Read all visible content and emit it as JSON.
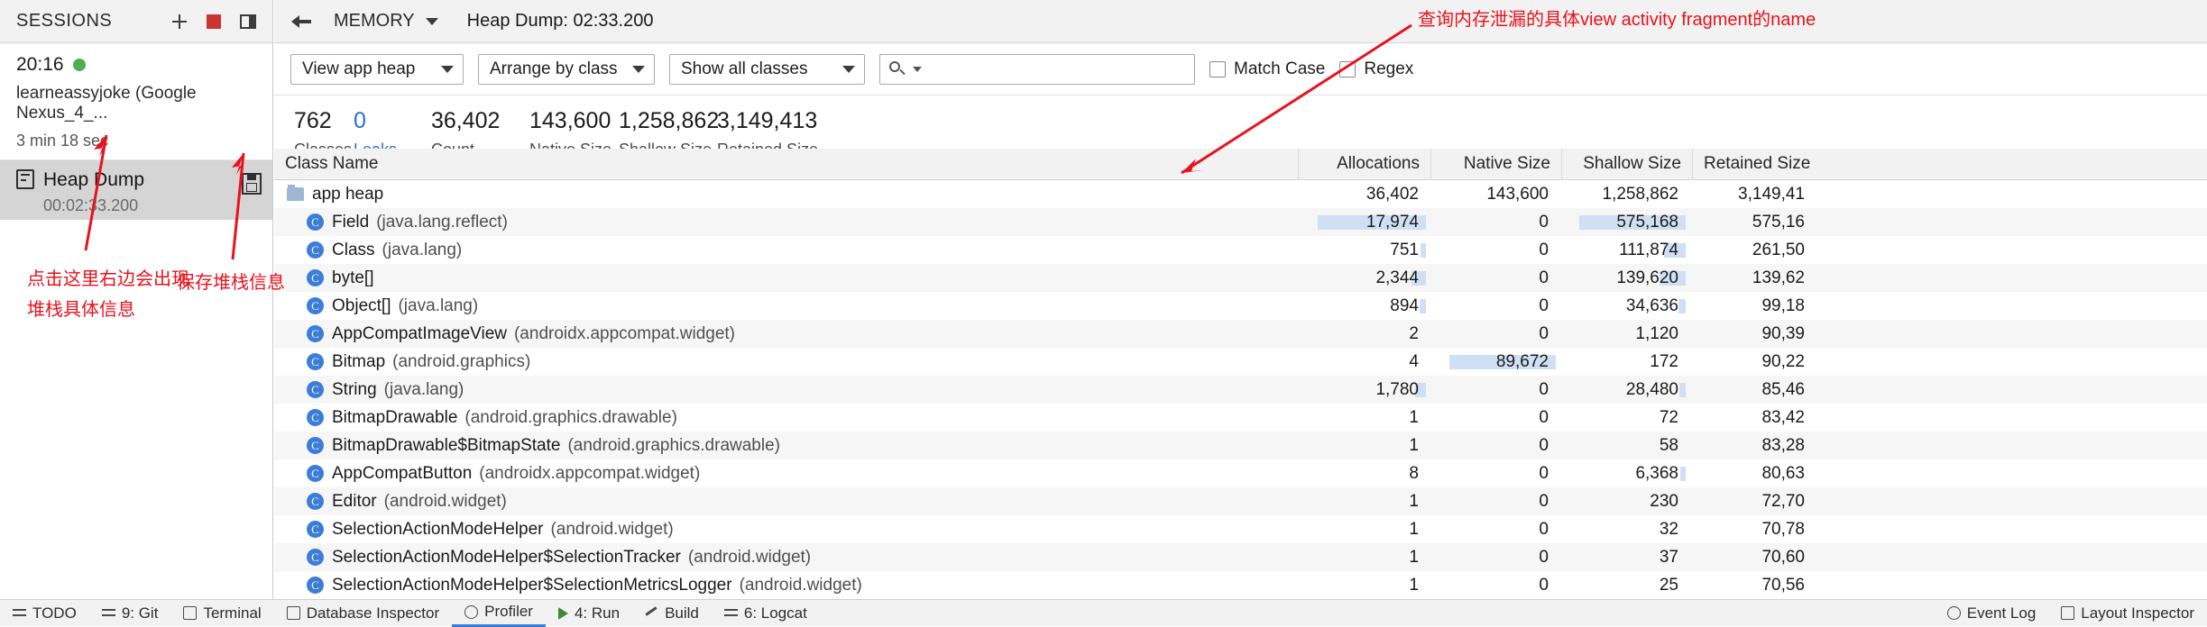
{
  "sidebar": {
    "title": "SESSIONS",
    "actions": [
      {
        "name": "add-session-button",
        "icon": "plus-icon"
      },
      {
        "name": "stop-session-button",
        "icon": "stop-icon"
      },
      {
        "name": "toggle-panel-button",
        "icon": "panel-icon"
      }
    ],
    "session": {
      "time": "20:16",
      "device": "learneassyjoke (Google Nexus_4_...",
      "duration": "3 min 18 sec"
    },
    "heap_dump": {
      "label": "Heap Dump",
      "timestamp": "00:02:33.200",
      "save_icon": "save-icon"
    }
  },
  "toolbar": {
    "back_icon": "back-arrow-icon",
    "stage_label": "MEMORY",
    "dump_label": "Heap Dump: 02:33.200"
  },
  "filters": {
    "heap_select": "View app heap",
    "arrange_select": "Arrange by class",
    "classes_select": "Show all classes",
    "search_placeholder": "",
    "search_value": "",
    "match_case_label": "Match Case",
    "regex_label": "Regex"
  },
  "stats": [
    {
      "value": "762",
      "key": "Classes",
      "link": false
    },
    {
      "value": "0",
      "key": "Leaks",
      "link": true
    },
    {
      "value": "36,402",
      "key": "Count",
      "link": false
    },
    {
      "value": "143,600",
      "key": "Native Size",
      "link": false
    },
    {
      "value": "1,258,862",
      "key": "Shallow Size",
      "link": false
    },
    {
      "value": "3,149,413",
      "key": "Retained Size",
      "link": false
    }
  ],
  "table": {
    "headers": [
      "Class Name",
      "Allocations",
      "Native Size",
      "Shallow Size",
      "Retained Size"
    ],
    "rows": [
      {
        "indent": 0,
        "icon": "folder-icon",
        "name": "app heap",
        "pkg": "",
        "alloc": "36,402",
        "native": "143,600",
        "shallow": "1,258,862",
        "retained": "3,149,41",
        "alloc_bar": 0,
        "native_bar": 0,
        "shallow_bar": 0
      },
      {
        "indent": 1,
        "icon": "class-icon",
        "name": "Field",
        "pkg": "(java.lang.reflect)",
        "alloc": "17,974",
        "native": "0",
        "shallow": "575,168",
        "retained": "575,16",
        "alloc_bar": 100,
        "native_bar": 0,
        "shallow_bar": 100
      },
      {
        "indent": 1,
        "icon": "class-icon",
        "name": "Class",
        "pkg": "(java.lang)",
        "alloc": "751",
        "native": "0",
        "shallow": "111,874",
        "retained": "261,50",
        "alloc_bar": 5,
        "native_bar": 0,
        "shallow_bar": 20
      },
      {
        "indent": 1,
        "icon": "class-icon",
        "name": "byte[]",
        "pkg": "",
        "alloc": "2,344",
        "native": "0",
        "shallow": "139,620",
        "retained": "139,62",
        "alloc_bar": 13,
        "native_bar": 0,
        "shallow_bar": 25
      },
      {
        "indent": 1,
        "icon": "class-icon",
        "name": "Object[]",
        "pkg": "(java.lang)",
        "alloc": "894",
        "native": "0",
        "shallow": "34,636",
        "retained": "99,18",
        "alloc_bar": 6,
        "native_bar": 0,
        "shallow_bar": 7
      },
      {
        "indent": 1,
        "icon": "class-icon",
        "name": "AppCompatImageView",
        "pkg": "(androidx.appcompat.widget)",
        "alloc": "2",
        "native": "0",
        "shallow": "1,120",
        "retained": "90,39",
        "alloc_bar": 0,
        "native_bar": 0,
        "shallow_bar": 0
      },
      {
        "indent": 1,
        "icon": "class-icon",
        "name": "Bitmap",
        "pkg": "(android.graphics)",
        "alloc": "4",
        "native": "89,672",
        "shallow": "172",
        "retained": "90,22",
        "alloc_bar": 0,
        "native_bar": 100,
        "shallow_bar": 0
      },
      {
        "indent": 1,
        "icon": "class-icon",
        "name": "String",
        "pkg": "(java.lang)",
        "alloc": "1,780",
        "native": "0",
        "shallow": "28,480",
        "retained": "85,46",
        "alloc_bar": 10,
        "native_bar": 0,
        "shallow_bar": 6
      },
      {
        "indent": 1,
        "icon": "class-icon",
        "name": "BitmapDrawable",
        "pkg": "(android.graphics.drawable)",
        "alloc": "1",
        "native": "0",
        "shallow": "72",
        "retained": "83,42",
        "alloc_bar": 0,
        "native_bar": 0,
        "shallow_bar": 0
      },
      {
        "indent": 1,
        "icon": "class-icon",
        "name": "BitmapDrawable$BitmapState",
        "pkg": "(android.graphics.drawable)",
        "alloc": "1",
        "native": "0",
        "shallow": "58",
        "retained": "83,28",
        "alloc_bar": 0,
        "native_bar": 0,
        "shallow_bar": 0
      },
      {
        "indent": 1,
        "icon": "class-icon",
        "name": "AppCompatButton",
        "pkg": "(androidx.appcompat.widget)",
        "alloc": "8",
        "native": "0",
        "shallow": "6,368",
        "retained": "80,63",
        "alloc_bar": 0,
        "native_bar": 0,
        "shallow_bar": 1
      },
      {
        "indent": 1,
        "icon": "class-icon",
        "name": "Editor",
        "pkg": "(android.widget)",
        "alloc": "1",
        "native": "0",
        "shallow": "230",
        "retained": "72,70",
        "alloc_bar": 0,
        "native_bar": 0,
        "shallow_bar": 0
      },
      {
        "indent": 1,
        "icon": "class-icon",
        "name": "SelectionActionModeHelper",
        "pkg": "(android.widget)",
        "alloc": "1",
        "native": "0",
        "shallow": "32",
        "retained": "70,78",
        "alloc_bar": 0,
        "native_bar": 0,
        "shallow_bar": 0
      },
      {
        "indent": 1,
        "icon": "class-icon",
        "name": "SelectionActionModeHelper$SelectionTracker",
        "pkg": "(android.widget)",
        "alloc": "1",
        "native": "0",
        "shallow": "37",
        "retained": "70,60",
        "alloc_bar": 0,
        "native_bar": 0,
        "shallow_bar": 0
      },
      {
        "indent": 1,
        "icon": "class-icon",
        "name": "SelectionActionModeHelper$SelectionMetricsLogger",
        "pkg": "(android.widget)",
        "alloc": "1",
        "native": "0",
        "shallow": "25",
        "retained": "70,56",
        "alloc_bar": 0,
        "native_bar": 0,
        "shallow_bar": 0
      }
    ]
  },
  "bottom_bar": {
    "left_items": [
      {
        "label": "TODO",
        "icon": "todo-icon",
        "active": false
      },
      {
        "label": "9: Git",
        "icon": "git-icon",
        "active": false
      },
      {
        "label": "Terminal",
        "icon": "terminal-icon",
        "active": false
      },
      {
        "label": "Database Inspector",
        "icon": "database-icon",
        "active": false
      },
      {
        "label": "Profiler",
        "icon": "profiler-icon",
        "active": true
      },
      {
        "label": "4: Run",
        "icon": "run-icon",
        "active": false
      },
      {
        "label": "Build",
        "icon": "build-icon",
        "active": false
      },
      {
        "label": "6: Logcat",
        "icon": "logcat-icon",
        "active": false
      }
    ],
    "right_items": [
      {
        "label": "Event Log",
        "icon": "event-log-icon"
      },
      {
        "label": "Layout Inspector",
        "icon": "layout-inspector-icon"
      }
    ]
  },
  "annotations": [
    {
      "name": "annotation-find-leak",
      "text": "查询内存泄漏的具体view activity fragment的name"
    },
    {
      "name": "annotation-click-here",
      "text": "点击这里右边会出现\n堆栈具体信息"
    },
    {
      "name": "annotation-save-heap",
      "text": "保存堆栈信息"
    }
  ],
  "colors": {
    "annotation": "#e8121d",
    "accent": "#3b7dd8",
    "bar": "#cfe0f4",
    "link": "#2a6fc9",
    "stop": "#cc3333",
    "green": "#4caf50"
  }
}
